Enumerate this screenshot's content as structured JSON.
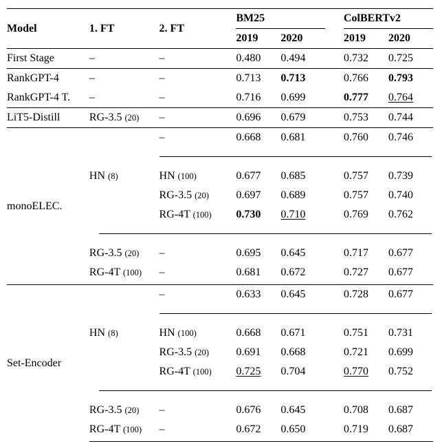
{
  "chart_data": {
    "type": "table",
    "title": "",
    "columns": [
      "Model",
      "1. FT",
      "2. FT",
      "BM25 2019",
      "BM25 2020",
      "ColBERTv2 2019",
      "ColBERTv2 2020"
    ],
    "rows": [
      [
        "First Stage",
        "–",
        "–",
        0.48,
        0.494,
        0.732,
        0.725
      ],
      [
        "RankGPT-4",
        "–",
        "–",
        0.713,
        0.713,
        0.766,
        0.793
      ],
      [
        "RankGPT-4 T.",
        "–",
        "–",
        0.716,
        0.699,
        0.777,
        0.764
      ],
      [
        "LiT5-Distill",
        "RG-3.5 (20)",
        "–",
        0.696,
        0.679,
        0.753,
        0.744
      ],
      [
        "monoELEC.",
        "HN (8)",
        "–",
        0.668,
        0.681,
        0.76,
        0.746
      ],
      [
        "monoELEC.",
        "HN (8)",
        "HN (100)",
        0.677,
        0.685,
        0.757,
        0.739
      ],
      [
        "monoELEC.",
        "HN (8)",
        "RG-3.5 (20)",
        0.697,
        0.689,
        0.757,
        0.74
      ],
      [
        "monoELEC.",
        "HN (8)",
        "RG-4T (100)",
        0.73,
        0.71,
        0.769,
        0.762
      ],
      [
        "monoELEC.",
        "RG-3.5 (20)",
        "–",
        0.695,
        0.645,
        0.717,
        0.677
      ],
      [
        "monoELEC.",
        "RG-4T (100)",
        "–",
        0.681,
        0.672,
        0.727,
        0.677
      ],
      [
        "Set-Encoder",
        "HN (8)",
        "–",
        0.633,
        0.645,
        0.728,
        0.677
      ],
      [
        "Set-Encoder",
        "HN (8)",
        "HN (100)",
        0.668,
        0.671,
        0.751,
        0.731
      ],
      [
        "Set-Encoder",
        "HN (8)",
        "RG-3.5 (20)",
        0.691,
        0.668,
        0.721,
        0.699
      ],
      [
        "Set-Encoder",
        "HN (8)",
        "RG-4T (100)",
        0.725,
        0.704,
        0.77,
        0.752
      ],
      [
        "Set-Encoder",
        "RG-3.5 (20)",
        "–",
        0.676,
        0.645,
        0.708,
        0.687
      ],
      [
        "Set-Encoder",
        "RG-4T (100)",
        "–",
        0.672,
        0.65,
        0.719,
        0.687
      ]
    ]
  },
  "head": {
    "model": "Model",
    "ft1": "1. FT",
    "ft2": "2. FT",
    "bm25": "BM25",
    "colbert": "ColBERTv2",
    "y19": "2019",
    "y20": "2020"
  },
  "ft": {
    "hn8_a": "HN ",
    "hn8_b": "(8)",
    "hn100_a": "HN ",
    "hn100_b": "(100)",
    "rg35_a": "RG-3.5 ",
    "rg35_b": "(20)",
    "rg4t_a": "RG-4T ",
    "rg4t_b": "(100)"
  },
  "dash": "–",
  "rows": {
    "first": {
      "m": "First Stage",
      "b19": "0.480",
      "b20": "0.494",
      "c19": "0.732",
      "c20": "0.725"
    },
    "rg4": {
      "m": "RankGPT-4",
      "b19": "0.713",
      "b20": "0.713",
      "c19": "0.766",
      "c20": "0.793"
    },
    "rg4t": {
      "m": "RankGPT-4 T.",
      "b19": "0.716",
      "b20": "0.699",
      "c19": "0.777",
      "c20": "0.764"
    },
    "lit5": {
      "m": "LiT5-Distill",
      "b19": "0.696",
      "b20": "0.679",
      "c19": "0.753",
      "c20": "0.744"
    },
    "me": {
      "m": "monoELEC."
    },
    "me1": {
      "b19": "0.668",
      "b20": "0.681",
      "c19": "0.760",
      "c20": "0.746"
    },
    "me2": {
      "b19": "0.677",
      "b20": "0.685",
      "c19": "0.757",
      "c20": "0.739"
    },
    "me3": {
      "b19": "0.697",
      "b20": "0.689",
      "c19": "0.757",
      "c20": "0.740"
    },
    "me4": {
      "b19": "0.730",
      "b20": "0.710",
      "c19": "0.769",
      "c20": "0.762"
    },
    "me5": {
      "b19": "0.695",
      "b20": "0.645",
      "c19": "0.717",
      "c20": "0.677"
    },
    "me6": {
      "b19": "0.681",
      "b20": "0.672",
      "c19": "0.727",
      "c20": "0.677"
    },
    "se": {
      "m": "Set-Encoder"
    },
    "se1": {
      "b19": "0.633",
      "b20": "0.645",
      "c19": "0.728",
      "c20": "0.677"
    },
    "se2": {
      "b19": "0.668",
      "b20": "0.671",
      "c19": "0.751",
      "c20": "0.731"
    },
    "se3": {
      "b19": "0.691",
      "b20": "0.668",
      "c19": "0.721",
      "c20": "0.699"
    },
    "se4": {
      "b19": "0.725",
      "b20": "0.704",
      "c19": "0.770",
      "c20": "0.752"
    },
    "se5": {
      "b19": "0.676",
      "b20": "0.645",
      "c19": "0.708",
      "c20": "0.687"
    },
    "se6": {
      "b19": "0.672",
      "b20": "0.650",
      "c19": "0.719",
      "c20": "0.687"
    }
  }
}
